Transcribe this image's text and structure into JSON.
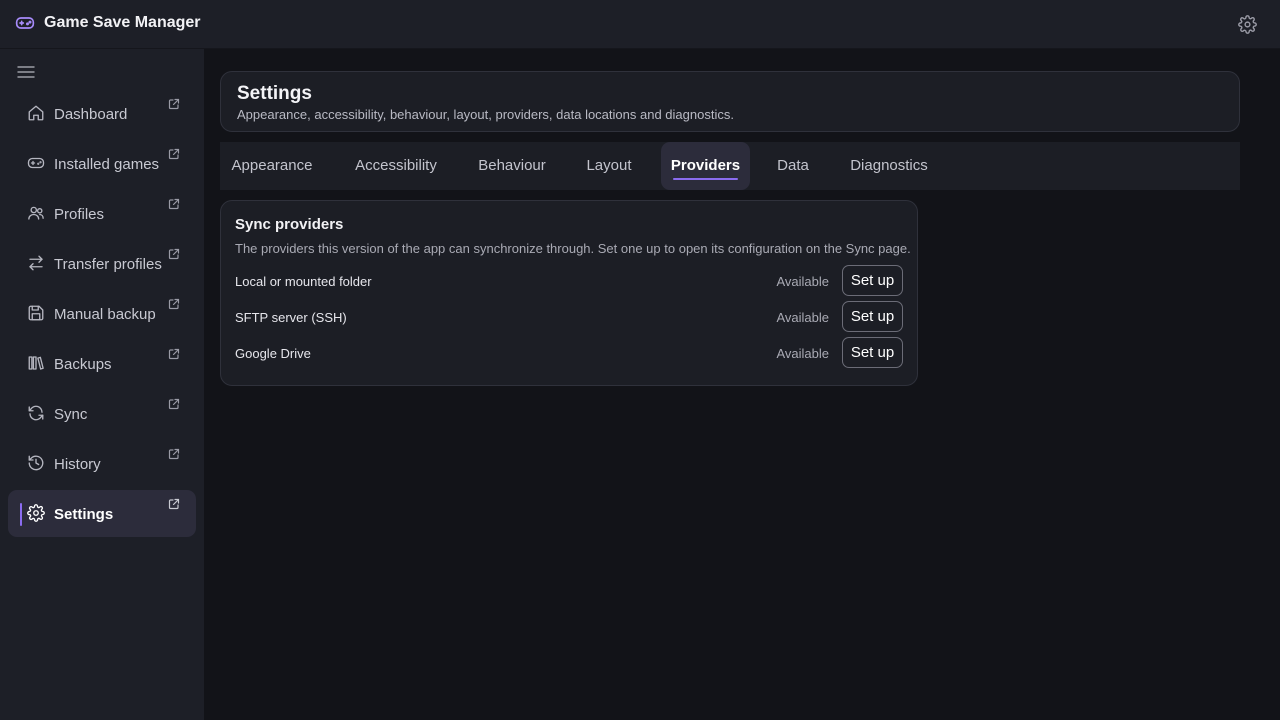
{
  "app": {
    "title": "Game Save Manager",
    "logo_icon": "gamepad-icon",
    "settings_icon": "gear-icon",
    "accent_color": "#8b6cf0"
  },
  "sidebar": {
    "toggle_icon": "hamburger-menu-icon",
    "items": [
      {
        "label": "Dashboard",
        "icon": "home-icon",
        "active": false
      },
      {
        "label": "Installed games",
        "icon": "gamepad-icon",
        "active": false
      },
      {
        "label": "Profiles",
        "icon": "users-icon",
        "active": false
      },
      {
        "label": "Transfer profiles",
        "icon": "arrows-left-right-icon",
        "active": false
      },
      {
        "label": "Manual backup",
        "icon": "floppy-disk-icon",
        "active": false
      },
      {
        "label": "Backups",
        "icon": "library-icon",
        "active": false
      },
      {
        "label": "Sync",
        "icon": "refresh-icon",
        "active": false
      },
      {
        "label": "History",
        "icon": "history-icon",
        "active": false
      },
      {
        "label": "Settings",
        "icon": "gear-icon",
        "active": true
      }
    ],
    "external_link_icon": "external-link-icon"
  },
  "header": {
    "title": "Settings",
    "subtitle": "Appearance, accessibility, behaviour, layout, providers, data locations and diagnostics."
  },
  "tabs": [
    {
      "label": "Appearance",
      "active": false
    },
    {
      "label": "Accessibility",
      "active": false
    },
    {
      "label": "Behaviour",
      "active": false
    },
    {
      "label": "Layout",
      "active": false
    },
    {
      "label": "Providers",
      "active": true
    },
    {
      "label": "Data",
      "active": false
    },
    {
      "label": "Diagnostics",
      "active": false
    }
  ],
  "providers": {
    "title": "Sync providers",
    "description": "The providers this version of the app can synchronize through. Set one up to open its configuration on the Sync page.",
    "rows": [
      {
        "name": "Local or mounted folder",
        "status": "Available",
        "button": "Set up"
      },
      {
        "name": "SFTP server (SSH)",
        "status": "Available",
        "button": "Set up"
      },
      {
        "name": "Google Drive",
        "status": "Available",
        "button": "Set up"
      }
    ]
  }
}
